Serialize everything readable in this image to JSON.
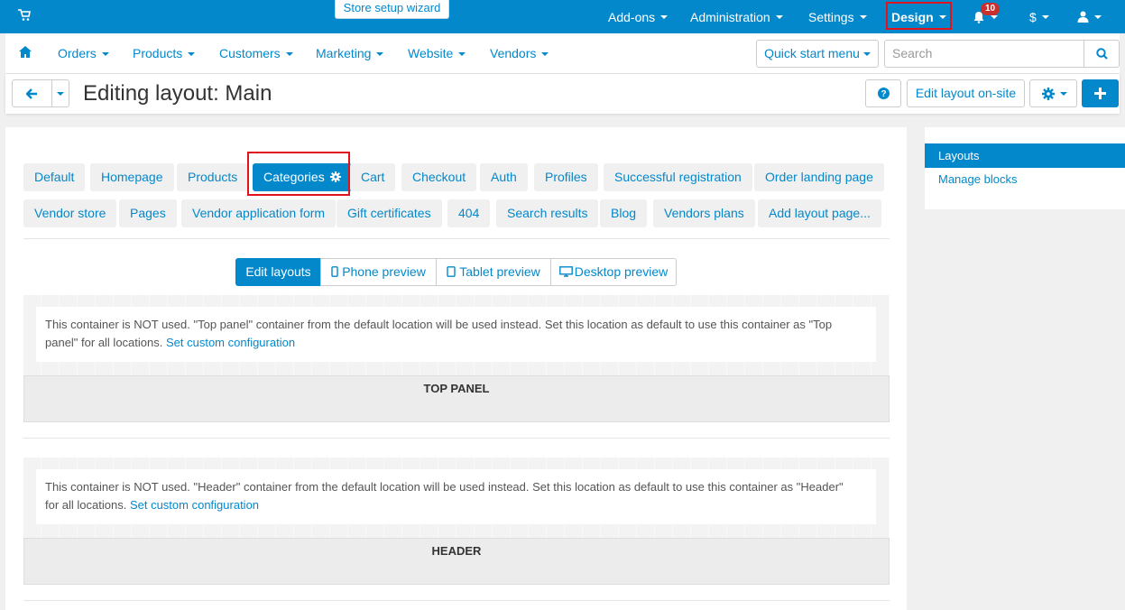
{
  "topbar": {
    "wizard_label": "Store setup wizard",
    "items": [
      {
        "label": "Add-ons"
      },
      {
        "label": "Administration"
      },
      {
        "label": "Settings"
      },
      {
        "label": "Design"
      }
    ],
    "notification_count": "10",
    "currency_label": "$"
  },
  "mainnav": {
    "items": [
      {
        "label": "Orders"
      },
      {
        "label": "Products"
      },
      {
        "label": "Customers"
      },
      {
        "label": "Marketing"
      },
      {
        "label": "Website"
      },
      {
        "label": "Vendors"
      }
    ],
    "quick_start_label": "Quick start menu",
    "search_placeholder": "Search"
  },
  "titlebar": {
    "title": "Editing layout: Main",
    "edit_onsite_label": "Edit layout on-site"
  },
  "layout_tabs": [
    {
      "label": "Default"
    },
    {
      "label": "Homepage"
    },
    {
      "label": "Products"
    },
    {
      "label": "Categories"
    },
    {
      "label": "Cart"
    },
    {
      "label": "Checkout"
    },
    {
      "label": "Auth"
    },
    {
      "label": "Profiles"
    },
    {
      "label": "Successful registration"
    },
    {
      "label": "Order landing page"
    },
    {
      "label": "Vendor store"
    },
    {
      "label": "Pages"
    },
    {
      "label": "Vendor application form"
    },
    {
      "label": "Gift certificates"
    },
    {
      "label": "404"
    },
    {
      "label": "Search results"
    },
    {
      "label": "Blog"
    },
    {
      "label": "Vendors plans"
    },
    {
      "label": "Add layout page..."
    }
  ],
  "preview_tabs": [
    {
      "label": "Edit layouts"
    },
    {
      "label": "Phone preview"
    },
    {
      "label": "Tablet preview"
    },
    {
      "label": "Desktop preview"
    }
  ],
  "containers": [
    {
      "notice_line1": "This container is NOT used. \"Top panel\" container from the default location will be used instead. Set this location as default to use this container as \"Top",
      "notice_line2": "panel\" for all locations.",
      "link": "Set custom configuration",
      "label": "TOP PANEL"
    },
    {
      "notice_line1": "This container is NOT used. \"Header\" container from the default location will be used instead. Set this location as default to use this container as \"Header\"",
      "notice_line2": "for all locations.",
      "link": "Set custom configuration",
      "label": "HEADER"
    }
  ],
  "sidebar": {
    "active_item": "Layouts",
    "item": "Manage blocks"
  },
  "colors": {
    "accent": "#0388cc",
    "highlight": "#e0141e"
  }
}
